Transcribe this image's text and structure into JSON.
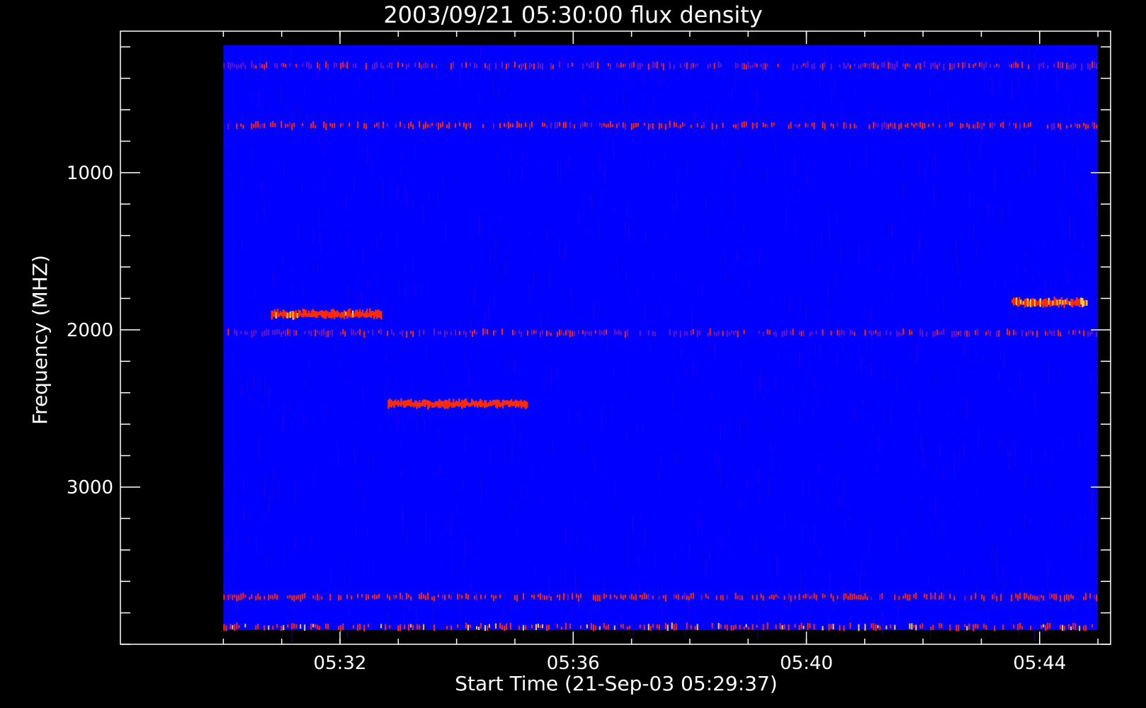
{
  "chart_data": {
    "type": "heatmap",
    "title": "2003/09/21 05:30:00 flux density",
    "xlabel": "Start Time (21-Sep-03 05:29:37)",
    "ylabel": "Frequency (MHZ)",
    "x_tick_labels": [
      "05:32",
      "05:36",
      "05:40",
      "05:44"
    ],
    "x_tick_values_min": [
      2.383,
      6.383,
      10.383,
      14.383
    ],
    "xlim_min": [
      -1.383,
      15.6
    ],
    "ylim": [
      100,
      4000
    ],
    "y_tick_labels": [
      "1000",
      "2000",
      "3000"
    ],
    "y_tick_values": [
      1000,
      2000,
      3000
    ],
    "data_range_x_min": [
      0.383,
      15.383
    ],
    "data_range_y": [
      190,
      4070
    ],
    "colormap": [
      "#0000ff",
      "#ff2a00",
      "#ffcc33"
    ],
    "background_color": "#0000ff",
    "features": [
      {
        "x_min": [
          1.2,
          3.1
        ],
        "freq": 1900,
        "intensity": 0.85
      },
      {
        "x_min": [
          3.2,
          5.6
        ],
        "freq": 2470,
        "intensity": 0.55
      },
      {
        "x_min": [
          13.9,
          15.2
        ],
        "freq": 1825,
        "intensity": 0.95
      },
      {
        "x_min": [
          0.383,
          15.383
        ],
        "freq": 2020,
        "intensity": 0.35
      },
      {
        "x_min": [
          0.383,
          15.383
        ],
        "freq": 3890,
        "intensity": 0.9
      },
      {
        "x_min": [
          0.383,
          15.383
        ],
        "freq": 3700,
        "intensity": 0.5
      },
      {
        "x_min": [
          0.383,
          15.383
        ],
        "freq": 700,
        "intensity": 0.45
      },
      {
        "x_min": [
          0.383,
          15.383
        ],
        "freq": 320,
        "intensity": 0.35
      }
    ]
  }
}
